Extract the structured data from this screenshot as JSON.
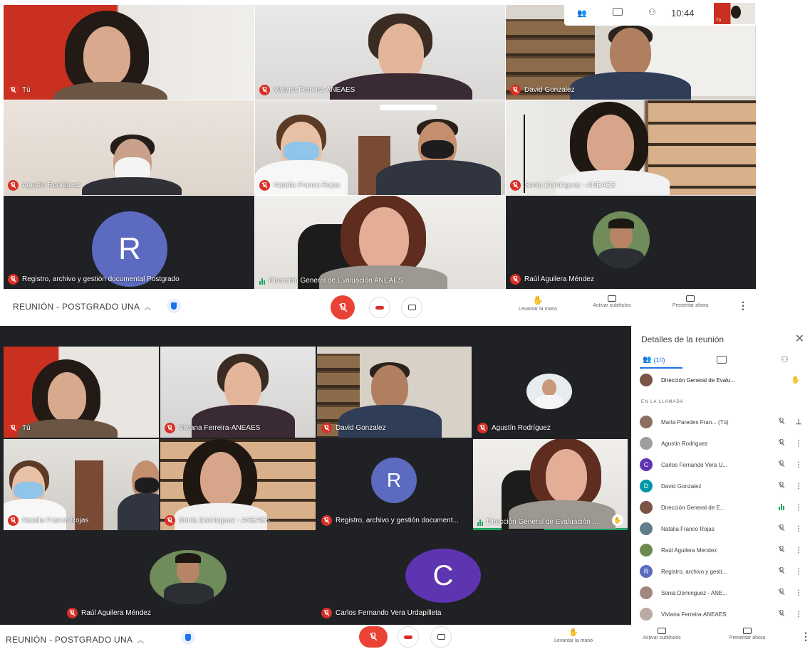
{
  "screenshot1": {
    "overlay": {
      "time": "10:44",
      "self_label": "Tú"
    },
    "tiles": [
      {
        "name": "Tú"
      },
      {
        "name": "Viviana Ferreira-ANEAES"
      },
      {
        "name": "David Gonzalez"
      },
      {
        "name": "Agustin Rodriguez"
      },
      {
        "name": "Natalia Franco Rojas"
      },
      {
        "name": "Sonia Dominguez - ANEAES"
      },
      {
        "name": "Registro, archivo y gestión documental Postgrado",
        "letter": "R"
      },
      {
        "name": "Dirección General de Evaluación ANEAES"
      },
      {
        "name": "Raúl Aguilera Méndez"
      }
    ],
    "controls": {
      "meeting_title": "REUNIÓN - POSTGRADO UNA",
      "raise_hand": "Levantar la mano",
      "captions": "Activar subtítulos",
      "present": "Presentar ahora"
    }
  },
  "screenshot2": {
    "tiles": [
      {
        "name": "Tú"
      },
      {
        "name": "Viviana Ferreira-ANEAES"
      },
      {
        "name": "David Gonzalez"
      },
      {
        "name": "Agustín Rodríguez"
      },
      {
        "name": "Natalia Franco Rojas"
      },
      {
        "name": "Sonia Dominguez - ANEAES"
      },
      {
        "name": "Registro, archivo y gestión document...",
        "letter": "R"
      },
      {
        "name": "Dirección General de Evaluación ..."
      },
      {
        "name": "Raúl Aguilera Méndez"
      },
      {
        "name": "Carlos Fernando Vera Urdapilleta",
        "letter": "C"
      }
    ],
    "controls": {
      "meeting_title": "REUNIÓN - POSTGRADO UNA",
      "raise_hand": "Levantar la mano",
      "captions": "Activar subtítulos",
      "present": "Presentar ahora"
    },
    "panel": {
      "title": "Detalles de la reunión",
      "people_count": "(10)",
      "hand_raised": "Dirección General de Evalu...",
      "section_label": "EN LA LLAMADA",
      "participants": [
        {
          "name": "Marta Paredes Fran... (Tú)",
          "avatar_color": "#8d6e63"
        },
        {
          "name": "Agustin Rodriguez",
          "avatar_color": "#9e9e9e"
        },
        {
          "name": "Carlos Fernando Vera U...",
          "avatar_color": "#5e35b1",
          "letter": "C"
        },
        {
          "name": "David Gonzalez",
          "avatar_color": "#0097a7",
          "letter": "D"
        },
        {
          "name": "Dirección General de E...",
          "avatar_color": "#795548"
        },
        {
          "name": "Natalia Franco Rojas",
          "avatar_color": "#607d8b"
        },
        {
          "name": "Raúl Aguilera Mendez",
          "avatar_color": "#6d8b4f"
        },
        {
          "name": "Registro, archivo y gesti...",
          "avatar_color": "#5c6bc0",
          "letter": "R"
        },
        {
          "name": "Sonia Dominguez - ANE...",
          "avatar_color": "#a1887f"
        },
        {
          "name": "Viviana Ferreira-ANEAES",
          "avatar_color": "#bcaaa4"
        }
      ]
    }
  },
  "colors": {
    "mic_off_red": "#d93025",
    "end_call_red": "#ea4335",
    "accent_blue": "#1a73e8",
    "avatar_r": "#5c6bc0",
    "avatar_c": "#5e35b1",
    "speaking_green": "#1ea362"
  }
}
